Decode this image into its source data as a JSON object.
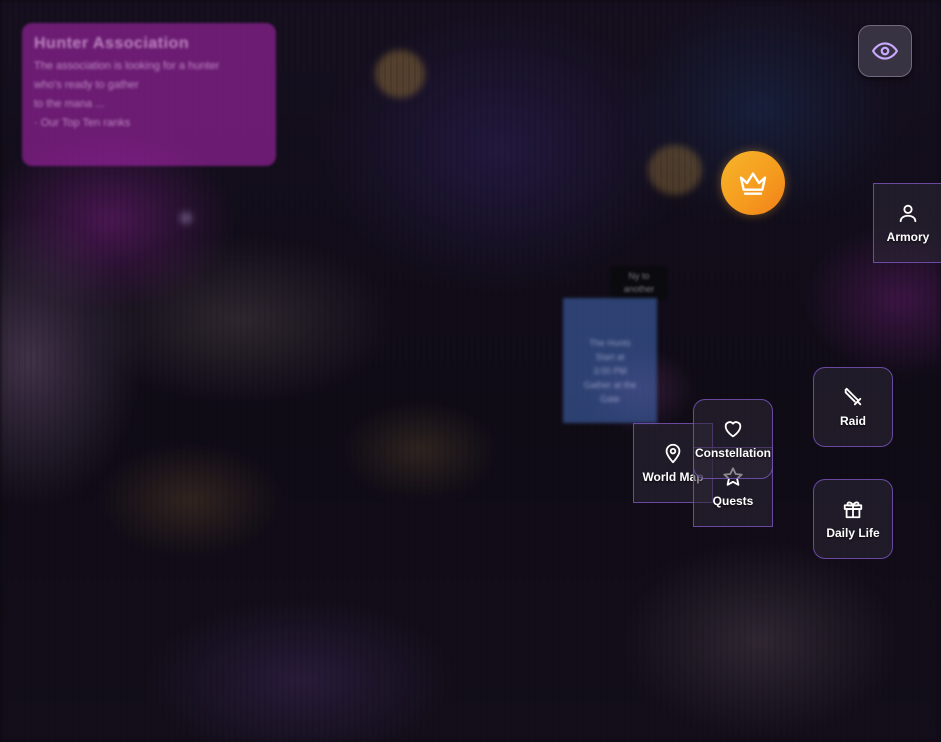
{
  "info_card": {
    "title": "Hunter Association",
    "lines": [
      "The association is looking for a hunter",
      "who's ready to gather",
      "to the mana ...",
      "·  Our Top Ten ranks"
    ]
  },
  "tooltip": {
    "lines": [
      "Ny to",
      "another"
    ]
  },
  "notice": {
    "lines": [
      "The Hunts",
      "Start at",
      "3:00 PM",
      "Gather at the",
      "Gate"
    ]
  },
  "buttons": {
    "eye": {
      "icon": "eye-icon",
      "color": "#c9a8ff"
    },
    "crown": {
      "icon": "crown-icon",
      "color": "#ffffff"
    },
    "armory": {
      "label": "Armory",
      "icon": "user-icon"
    },
    "raid": {
      "label": "Raid",
      "icon": "sword-icon"
    },
    "constellation": {
      "label": "Constellation",
      "icon": "heart-icon"
    },
    "world_map": {
      "label": "World Map",
      "icon": "map-pin-icon"
    },
    "quests": {
      "label": "Quests",
      "icon": "star-icon"
    },
    "daily_life": {
      "label": "Daily Life",
      "icon": "gift-icon"
    }
  },
  "colors": {
    "accent": "#8a5cf6",
    "crown_gradient_start": "#f7b52b",
    "crown_gradient_end": "#f07f1a"
  }
}
